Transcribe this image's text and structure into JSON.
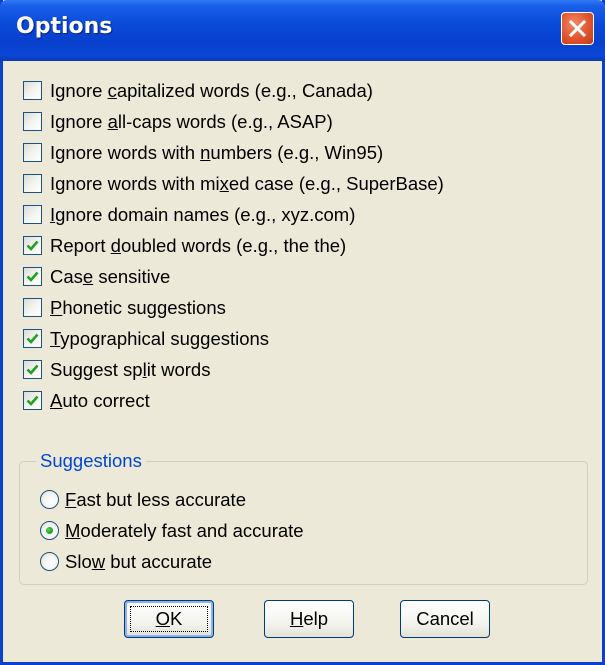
{
  "window": {
    "title": "Options"
  },
  "options": [
    {
      "pre": "Ignore ",
      "key": "c",
      "post": "apitalized words (e.g., Canada)",
      "checked": false
    },
    {
      "pre": "Ignore ",
      "key": "a",
      "post": "ll-caps words (e.g., ASAP)",
      "checked": false
    },
    {
      "pre": "Ignore words with ",
      "key": "n",
      "post": "umbers (e.g., Win95)",
      "checked": false
    },
    {
      "pre": "Ignore words with mi",
      "key": "x",
      "post": "ed case (e.g., SuperBase)",
      "checked": false
    },
    {
      "pre": "",
      "key": "I",
      "post": "gnore domain names (e.g., xyz.com)",
      "checked": false
    },
    {
      "pre": "Report ",
      "key": "d",
      "post": "oubled words (e.g., the the)",
      "checked": true
    },
    {
      "pre": "Cas",
      "key": "e",
      "post": " sensitive",
      "checked": true
    },
    {
      "pre": "",
      "key": "P",
      "post": "honetic suggestions",
      "checked": false
    },
    {
      "pre": "",
      "key": "T",
      "post": "ypographical suggestions",
      "checked": true
    },
    {
      "pre": "Suggest sp",
      "key": "l",
      "post": "it words",
      "checked": true
    },
    {
      "pre": "",
      "key": "A",
      "post": "uto correct",
      "checked": true
    }
  ],
  "suggestions": {
    "title": "Suggestions",
    "items": [
      {
        "pre": "",
        "key": "F",
        "post": "ast but less accurate",
        "selected": false
      },
      {
        "pre": "",
        "key": "M",
        "post": "oderately fast and accurate",
        "selected": true
      },
      {
        "pre": "Slo",
        "key": "w",
        "post": " but accurate",
        "selected": false
      }
    ]
  },
  "buttons": {
    "ok": {
      "pre": "",
      "key": "O",
      "post": "K"
    },
    "help": {
      "pre": "",
      "key": "H",
      "post": "elp"
    },
    "cancel": {
      "pre": "",
      "key": "",
      "post": "Cancel"
    }
  },
  "colors": {
    "title_bar": "#0a4ad8",
    "dialog_background": "#ece9d8",
    "check_mark": "#21a121",
    "group_title": "#0046d5",
    "close_button": "#e0542e"
  },
  "icons": {
    "close": "close-x-icon",
    "check": "check-mark-icon",
    "radio": "radio-dot-icon"
  }
}
